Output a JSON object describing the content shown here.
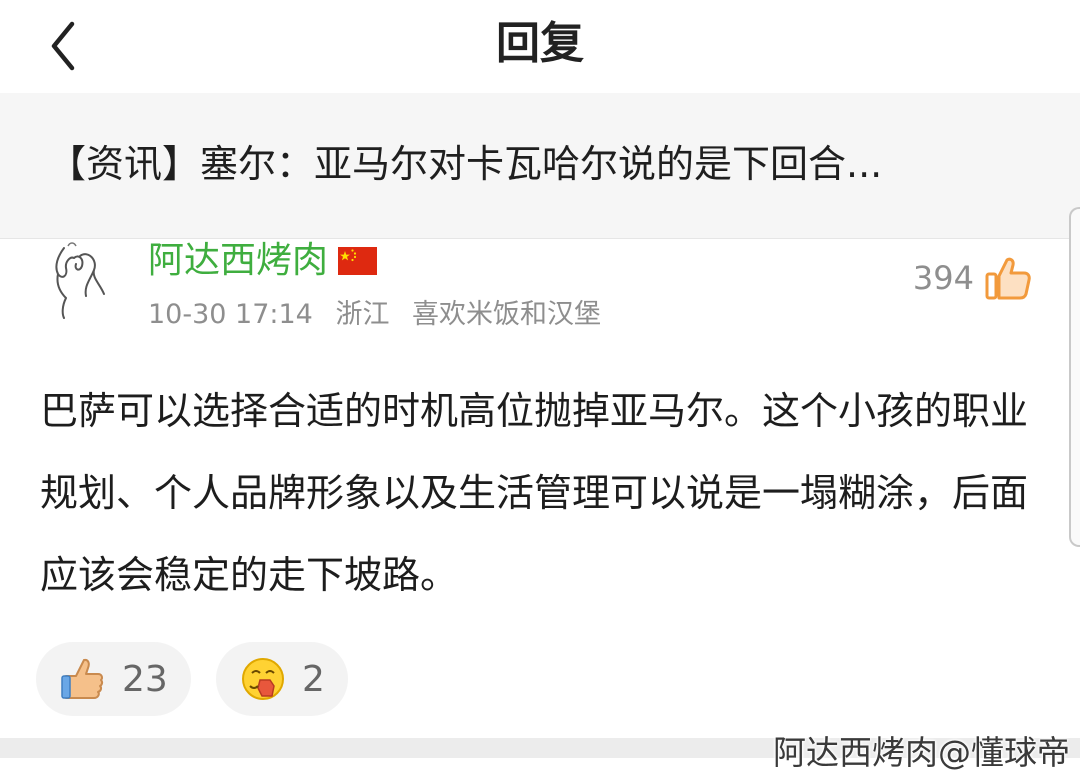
{
  "header": {
    "title": "回复",
    "back_icon": "chevron-left-icon"
  },
  "article": {
    "title": "【资讯】塞尔：亚马尔对卡瓦哈尔说的是下回合..."
  },
  "comment": {
    "username": "阿达西烤肉",
    "flag": "china-flag-icon",
    "date": "10-30 17:14",
    "location": "浙江",
    "signature": "喜欢米饭和汉堡",
    "likes": "394",
    "like_icon": "thumbs-up-icon",
    "text": "巴萨可以选择合适的时机高位抛掉亚马尔。这个小孩的职业规划、个人品牌形象以及生活管理可以说是一塌糊涂，后面应该会稳定的走下坡路。"
  },
  "reactions": [
    {
      "icon": "thumbs-up-emoji-icon",
      "count": "23"
    },
    {
      "icon": "facepalm-emoji-icon",
      "count": "2"
    }
  ],
  "watermark": "阿达西烤肉@懂球帝",
  "colors": {
    "username": "#3fae3f",
    "like_icon": "#f29a3c",
    "meta": "#8e8e8e"
  }
}
